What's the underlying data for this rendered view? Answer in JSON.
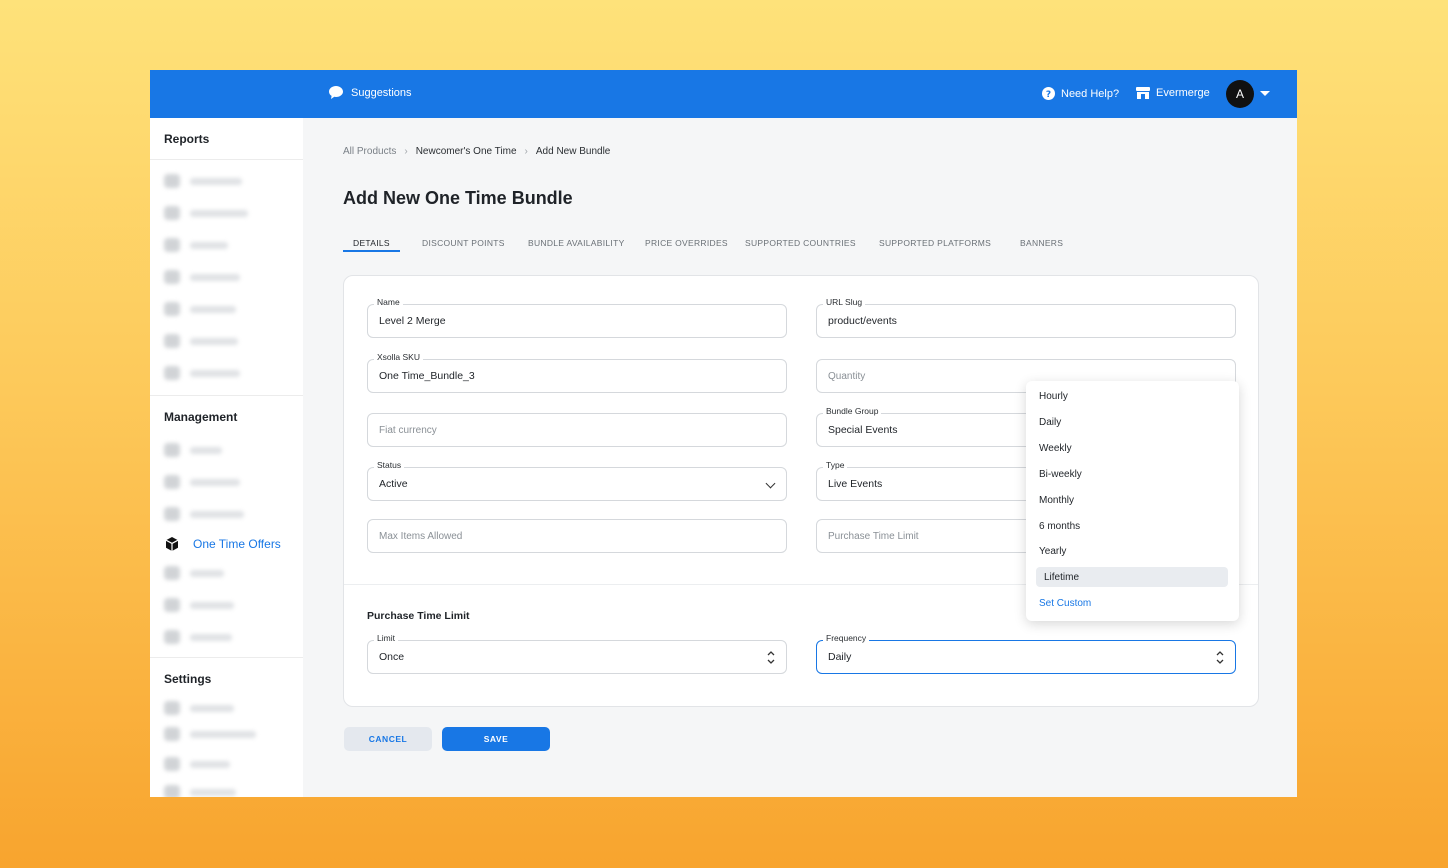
{
  "topbar": {
    "suggestions_label": "Suggestions",
    "help_label": "Need Help?",
    "org_name": "Evermerge",
    "avatar_letter": "A"
  },
  "sidebar": {
    "sections": {
      "reports": "Reports",
      "management": "Management",
      "settings": "Settings"
    },
    "active_item": "One Time Offers"
  },
  "breadcrumb": [
    "All Products",
    "Newcomer's One Time",
    "Add New Bundle"
  ],
  "page_title": "Add New One Time Bundle",
  "tabs": [
    {
      "label": "DETAILS",
      "active": true
    },
    {
      "label": "DISCOUNT POINTS",
      "active": false
    },
    {
      "label": "BUNDLE AVAILABILITY",
      "active": false
    },
    {
      "label": "PRICE OVERRIDES",
      "active": false
    },
    {
      "label": "SUPPORTED COUNTRIES",
      "active": false
    },
    {
      "label": "SUPPORTED PLATFORMS",
      "active": false
    },
    {
      "label": "BANNERS",
      "active": false
    }
  ],
  "form": {
    "name": {
      "label": "Name",
      "value": "Level 2 Merge"
    },
    "url_slug": {
      "label": "URL Slug",
      "value": "product/events"
    },
    "xsolla_sku": {
      "label": "Xsolla SKU",
      "value": "One Time_Bundle_3"
    },
    "quantity": {
      "placeholder": "Quantity"
    },
    "fiat_currency": {
      "placeholder": "Fiat currency"
    },
    "bundle_group": {
      "label": "Bundle Group",
      "value": "Special Events"
    },
    "status": {
      "label": "Status",
      "value": "Active"
    },
    "type": {
      "label": "Type",
      "value": "Live Events"
    },
    "max_items": {
      "placeholder": "Max Items Allowed"
    },
    "purchase_time_limit": {
      "placeholder": "Purchase Time Limit"
    }
  },
  "purchase_section": {
    "title": "Purchase Time Limit",
    "limit": {
      "label": "Limit",
      "value": "Once"
    },
    "frequency": {
      "label": "Frequency",
      "value": "Daily"
    }
  },
  "frequency_dropdown": {
    "options": [
      "Hourly",
      "Daily",
      "Weekly",
      "Bi-weekly",
      "Monthly",
      "6 months",
      "Yearly",
      "Lifetime"
    ],
    "highlighted": "Lifetime",
    "custom_link": "Set Custom"
  },
  "buttons": {
    "cancel": "CANCEL",
    "save": "SAVE"
  },
  "colors": {
    "accent": "#1877e5",
    "background_top": "#fee27a",
    "background_bottom": "#f8a42e"
  }
}
